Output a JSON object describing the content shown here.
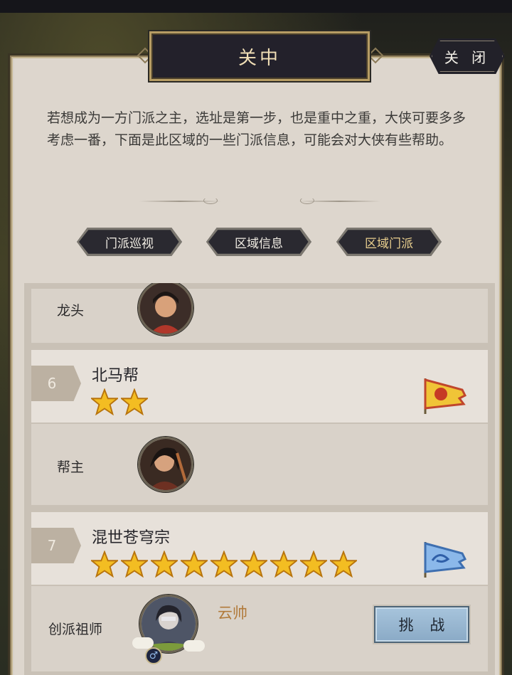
{
  "window": {
    "title": "关中",
    "close_label": "关 闭"
  },
  "description": "若想成为一方门派之主，选址是第一步，也是重中之重，大侠可要多多考虑一番，下面是此区域的一些门派信息，可能会对大侠有些帮助。",
  "tabs": [
    {
      "label": "门派巡视",
      "active": false
    },
    {
      "label": "区域信息",
      "active": false
    },
    {
      "label": "区域门派",
      "active": true
    }
  ],
  "sects": [
    {
      "rank": "",
      "name": "",
      "stars": 0,
      "role": "龙头",
      "leader": "",
      "partial": true
    },
    {
      "rank": "6",
      "name": "北马帮",
      "stars": 2,
      "flag": "red-dragon-flag",
      "role": "帮主",
      "leader": ""
    },
    {
      "rank": "7",
      "name": "混世苍穹宗",
      "stars": 9,
      "flag": "blue-dragon-flag",
      "role": "创派祖师",
      "leader": "云帅",
      "challenge_label": "挑 战",
      "gender": "♂"
    }
  ],
  "colors": {
    "accent_gold": "#b69c64",
    "leader_name": "#b17a3a",
    "challenge_bg": "#8aaac6",
    "panel_bg": "#ddd6cd"
  }
}
